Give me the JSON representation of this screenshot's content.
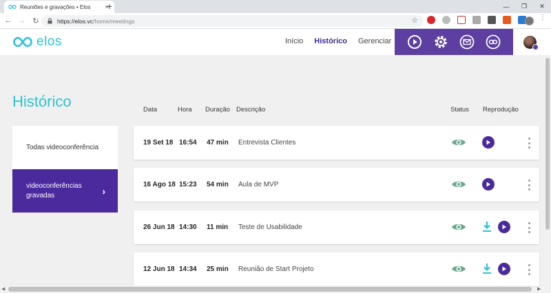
{
  "browser": {
    "tab_title": "Reuniões e gravações • Elos",
    "url_host": "https://elos.vc",
    "url_path": "/home/meetings",
    "tab_close": "×",
    "new_tab": "+",
    "minimize": "—",
    "restore": "❐",
    "close": "✕",
    "back": "←",
    "forward": "→",
    "reload": "↻",
    "bookmark": "☆",
    "menu": "⋮"
  },
  "brand": {
    "name": "elos",
    "accent": "#2ac4d6",
    "purple": "#5c3fa0",
    "deep_purple": "#4b2a9e",
    "green": "#6aa88e"
  },
  "nav": {
    "items": [
      {
        "label": "Início",
        "active": false
      },
      {
        "label": "Histórico",
        "active": true
      },
      {
        "label": "Gerenciar",
        "active": false
      }
    ]
  },
  "actions": [
    "play-circle-icon",
    "settings-icon",
    "mail-icon",
    "link-icon"
  ],
  "page": {
    "title": "Histórico"
  },
  "sidebar": {
    "items": [
      {
        "label": "Todas videoconferência",
        "active": false
      },
      {
        "label": "videoconferências gravadas",
        "active": true,
        "chevron": "›"
      }
    ]
  },
  "table": {
    "headers": {
      "date": "Data",
      "time": "Hora",
      "duration": "Duração",
      "description": "Descrição",
      "status": "Status",
      "playback": "Reprodução"
    },
    "rows": [
      {
        "date": "19 Set 18",
        "time": "16:54",
        "duration": "47 min",
        "description": "Entrevista Clientes",
        "download": false
      },
      {
        "date": "16 Ago 18",
        "time": "15:23",
        "duration": "54 min",
        "description": "Aula de MVP",
        "download": false
      },
      {
        "date": "26 Jun 18",
        "time": "14:30",
        "duration": "11 min",
        "description": "Teste de Usabilidade",
        "download": true
      },
      {
        "date": "12 Jun 18",
        "time": "14:34",
        "duration": "25 min",
        "description": "Reunião de Start Projeto",
        "download": true
      }
    ]
  }
}
